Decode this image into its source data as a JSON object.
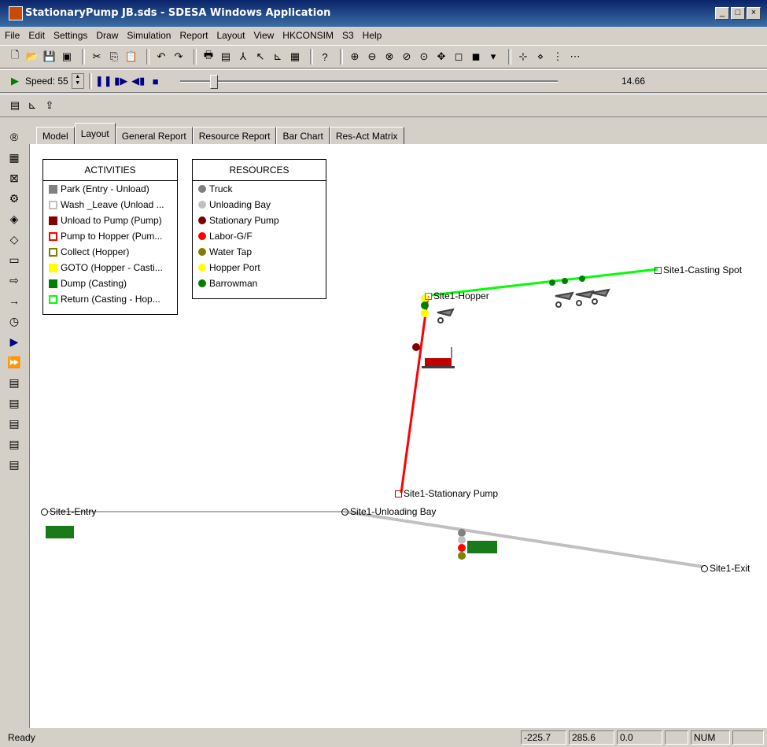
{
  "window": {
    "title": "StationaryPump JB.sds - SDESA Windows Application"
  },
  "menu": [
    "File",
    "Edit",
    "Settings",
    "Draw",
    "Simulation",
    "Report",
    "Layout",
    "View",
    "HKCONSIM",
    "S3",
    "Help"
  ],
  "sim": {
    "speed_label": "Speed: 55",
    "time": "14.66",
    "speed_progress": 0.08
  },
  "tabs": [
    "Model",
    "Layout",
    "General Report",
    "Resource Report",
    "Bar Chart",
    "Res-Act Matrix"
  ],
  "activities": {
    "title": "ACTIVITIES",
    "items": [
      {
        "label": "Park (Entry - Unload)",
        "color": "#808080",
        "style": "fill"
      },
      {
        "label": "Wash _Leave (Unload ...",
        "color": "#c0c0c0",
        "style": "outline"
      },
      {
        "label": "Unload to Pump (Pump)",
        "color": "#800000",
        "style": "fill"
      },
      {
        "label": "Pump to Hopper (Pum...",
        "color": "#ff0000",
        "style": "outline"
      },
      {
        "label": "Collect (Hopper)",
        "color": "#808000",
        "style": "outline"
      },
      {
        "label": "GOTO (Hopper - Casti...",
        "color": "#ffff00",
        "style": "fill"
      },
      {
        "label": "Dump (Casting)",
        "color": "#008000",
        "style": "fill"
      },
      {
        "label": "Return (Casting - Hop...",
        "color": "#00ff00",
        "style": "outline"
      }
    ]
  },
  "resources": {
    "title": "RESOURCES",
    "items": [
      {
        "label": "Truck",
        "color": "#808080"
      },
      {
        "label": "Unloading Bay",
        "color": "#c0c0c0"
      },
      {
        "label": "Stationary Pump",
        "color": "#800000"
      },
      {
        "label": "Labor-G/F",
        "color": "#ff0000"
      },
      {
        "label": "Water Tap",
        "color": "#808000"
      },
      {
        "label": "Hopper Port",
        "color": "#ffff00"
      },
      {
        "label": "Barrowman",
        "color": "#008000"
      }
    ]
  },
  "nodes": {
    "entry": "Site1-Entry",
    "unloading_bay": "Site1-Unloading Bay",
    "exit": "Site1-Exit",
    "stationary_pump": "Site1-Stationary Pump",
    "hopper": "Site1-Hopper",
    "casting_spot": "Site1-Casting Spot"
  },
  "status": {
    "text": "Ready",
    "coord_x": "-225.7",
    "coord_y": "285.6",
    "value": "0.0",
    "num": "NUM"
  }
}
